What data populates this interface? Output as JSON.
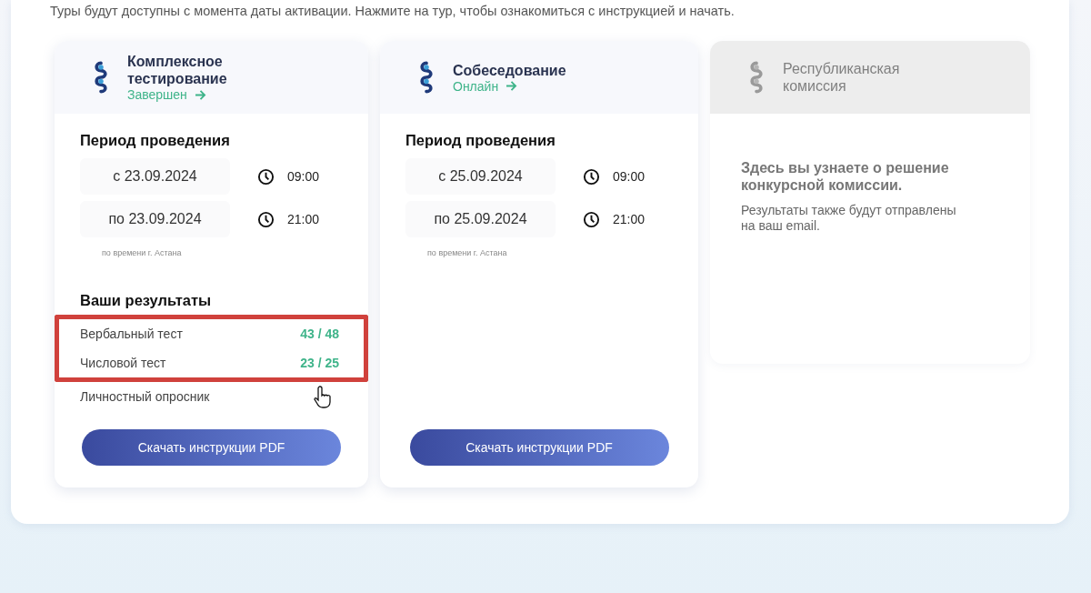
{
  "intro": "Туры будут доступны с момента даты активации. Нажмите на тур, чтобы ознакомиться с инструкцией и начать.",
  "cards": [
    {
      "title": "Комплексное тестирование",
      "status": "Завершен",
      "disabled": false,
      "period": {
        "heading": "Период проведения",
        "from_date": "с 23.09.2024",
        "from_time": "09:00",
        "to_date": "по 23.09.2024",
        "to_time": "21:00",
        "note": "по времени г. Астана"
      },
      "results": {
        "heading": "Ваши результаты",
        "rows": [
          {
            "label": "Вербальный тест",
            "score": "43 / 48",
            "highlighted": true
          },
          {
            "label": "Числовой тест",
            "score": "23 / 25",
            "highlighted": true
          },
          {
            "label": "Личностный опросник",
            "highlighted": false
          }
        ]
      },
      "button": "Скачать инструкции PDF"
    },
    {
      "title": "Собеседование",
      "status": "Онлайн",
      "disabled": false,
      "period": {
        "heading": "Период проведения",
        "from_date": "с 25.09.2024",
        "from_time": "09:00",
        "to_date": "по 25.09.2024",
        "to_time": "21:00",
        "note": "по времени г. Астана"
      },
      "button": "Скачать инструкции PDF"
    },
    {
      "title": "Республиканская комиссия",
      "disabled": true,
      "description": [
        "Здесь вы узнаете о решение конкурсной комиссии.",
        "Результаты также будут отправлены на ваш email."
      ]
    }
  ]
}
